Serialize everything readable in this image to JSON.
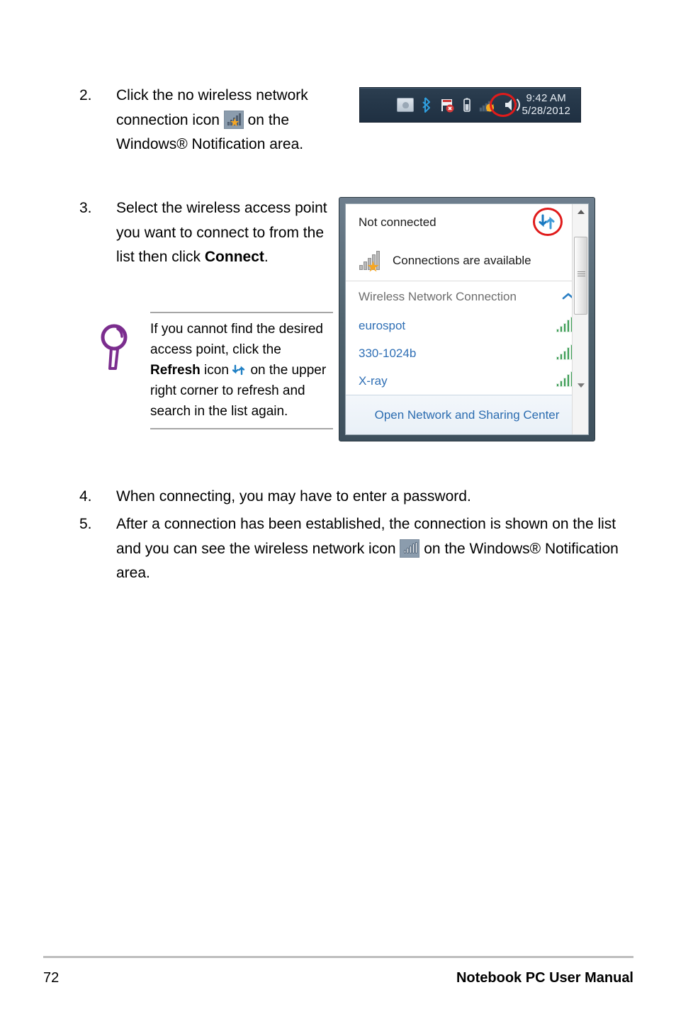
{
  "document": {
    "footer": {
      "page_number": "72",
      "manual_title": "Notebook PC User Manual"
    }
  },
  "steps": [
    {
      "number": "2.",
      "text_before_icon": "Click the no wireless network connection icon",
      "icon": "no-wireless-network-icon",
      "text_after_icon": "on the Windows® Notification area."
    },
    {
      "number": "3.",
      "text": "Select the wireless access point you want to connect to from the list then click",
      "bold_word": "Connect",
      "trailing": "."
    },
    {
      "number": "4.",
      "text": "When connecting, you may have to enter a password."
    },
    {
      "number": "5.",
      "text_before_icon": "After a connection has been established, the connection is shown on the list and you can see the wireless network icon",
      "icon": "wireless-network-connected-icon",
      "text_after_icon": "on the Windows® Notification area."
    }
  ],
  "note": {
    "icon": "magnifier-icon",
    "icon_color": "#7B2D8E",
    "text_part1": "If you cannot find the desired access point, click the",
    "bold_word": "Refresh",
    "text_part2": "icon",
    "inline_icon": "refresh-icon",
    "text_part3": "on the upper right corner to refresh and search in the list again."
  },
  "tray_screenshot": {
    "name": "windows-notification-area",
    "background_color": "#26384a",
    "icons": [
      "safely-remove-hardware-icon",
      "bluetooth-icon",
      "action-center-flag-icon",
      "battery-icon",
      "no-wireless-network-icon",
      "volume-speaker-icon"
    ],
    "highlight": {
      "target": "no-wireless-network-icon",
      "color": "#e01b1b",
      "shape": "circle"
    },
    "clock": {
      "time": "9:42 AM",
      "date": "5/28/2012"
    }
  },
  "network_popup": {
    "name": "wireless-networks-flyout",
    "status": "Not connected",
    "availability": {
      "icon": "connections-available-icon",
      "label": "Connections are available"
    },
    "refresh_button": {
      "icon": "refresh-icon",
      "highlight_color": "#e01b1b"
    },
    "group": {
      "label": "Wireless Network Connection",
      "chevron": "chevron-up-icon",
      "chevron_color": "#2b7fc4"
    },
    "networks": [
      {
        "ssid": "eurospot",
        "signal_icon": "signal-bars-icon",
        "signal_bars": 5
      },
      {
        "ssid": "330-1024b",
        "signal_icon": "signal-bars-icon",
        "signal_bars": 5
      },
      {
        "ssid": "X-ray",
        "signal_icon": "signal-bars-icon",
        "signal_bars": 5
      }
    ],
    "footer_link": "Open Network and Sharing Center",
    "scrollbar": {
      "up_arrow": "scroll-up-arrow-icon",
      "down_arrow": "scroll-down-arrow-icon"
    }
  }
}
